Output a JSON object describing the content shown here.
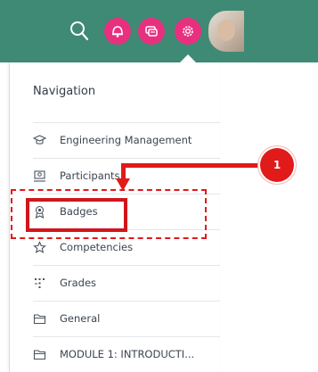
{
  "topbar": {
    "color": "#3f8a74",
    "icons": [
      "search-icon",
      "notifications-icon",
      "messages-icon",
      "settings-icon"
    ],
    "accent": "#e8307f"
  },
  "navigation": {
    "title": "Navigation",
    "items": [
      {
        "label": "Engineering Management",
        "icon": "graduation-cap-icon"
      },
      {
        "label": "Participants",
        "icon": "users-icon"
      },
      {
        "label": "Badges",
        "icon": "badge-icon"
      },
      {
        "label": "Competencies",
        "icon": "star-icon"
      },
      {
        "label": "Grades",
        "icon": "table-icon"
      },
      {
        "label": "General",
        "icon": "folder-icon"
      },
      {
        "label": "MODULE 1: INTRODUCTI...",
        "icon": "folder-icon"
      }
    ]
  },
  "annotation": {
    "step_number": "1",
    "color": "#e11a1a"
  }
}
